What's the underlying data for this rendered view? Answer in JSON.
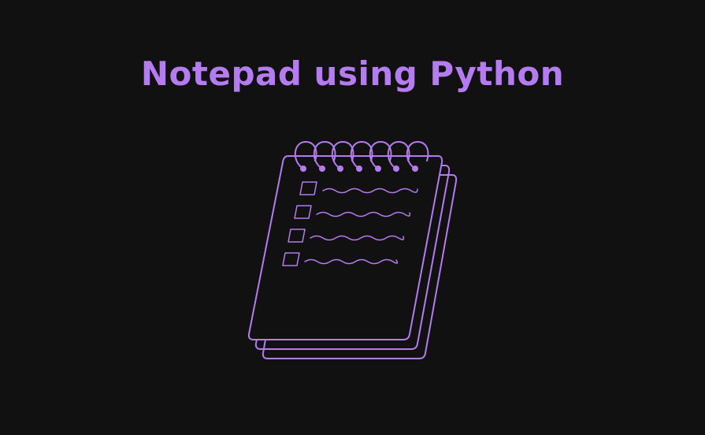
{
  "page": {
    "title": "Notepad using Python"
  },
  "illustration": {
    "name": "notepad-icon",
    "checklist_rows": 4,
    "spiral_rings": 7
  },
  "colors": {
    "background": "#111111",
    "accent": "#b57bf0"
  }
}
